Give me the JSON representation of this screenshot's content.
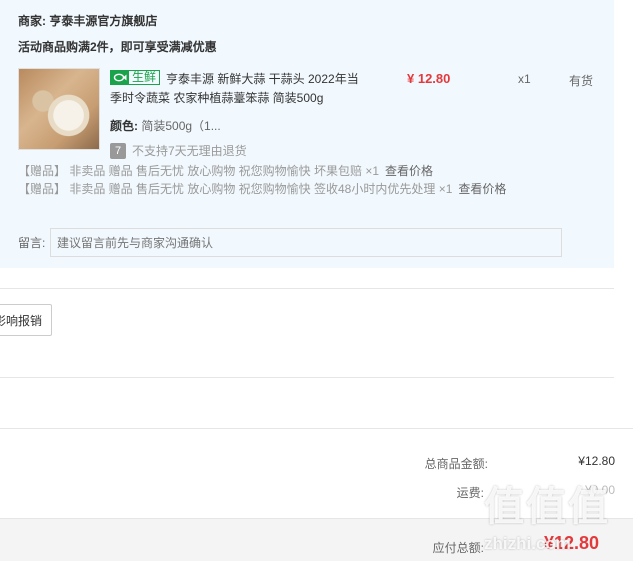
{
  "shop": {
    "label": "商家:",
    "name": "亨泰丰源官方旗舰店"
  },
  "promo": "活动商品购满2件，即可享受满减优惠",
  "product": {
    "tag_icon": "fish-icon",
    "tag_label": "生鲜",
    "name": "亨泰丰源 新鲜大蒜 干蒜头 2022年当季时令蔬菜 农家种植蒜薹笨蒜 简装500g",
    "price": "¥ 12.80",
    "qty": "x1",
    "stock": "有货",
    "color_label": "颜色:",
    "color_value": "简装500g（1...",
    "return_badge": "7",
    "return_note": "不支持7天无理由退货"
  },
  "gifts": [
    {
      "text": "【赠品】  非卖品 赠品 售后无忧 放心购物 祝您购物愉快 坏果包赔 ×1",
      "link": "查看价格"
    },
    {
      "text": "【赠品】  非卖品 赠品 售后无忧 放心购物 祝您购物愉快 签收48小时内优先处理 ×1",
      "link": "查看价格"
    }
  ],
  "message": {
    "label": "留言:",
    "placeholder": "建议留言前先与商家沟通确认"
  },
  "invoice_button": "影响报销",
  "summary": {
    "goods_label": "总商品金额:",
    "goods_value": "¥12.80",
    "shipping_label": "运费:",
    "shipping_value": "¥0.00",
    "payable_label": "应付总额:",
    "payable_value": "¥12.80"
  },
  "watermark": {
    "logo": "值值值",
    "site": "zhizhi.com"
  },
  "colors": {
    "accent_red": "#e4393c",
    "fresh_green": "#1aa34a",
    "card_bg": "#f2f9fe"
  }
}
